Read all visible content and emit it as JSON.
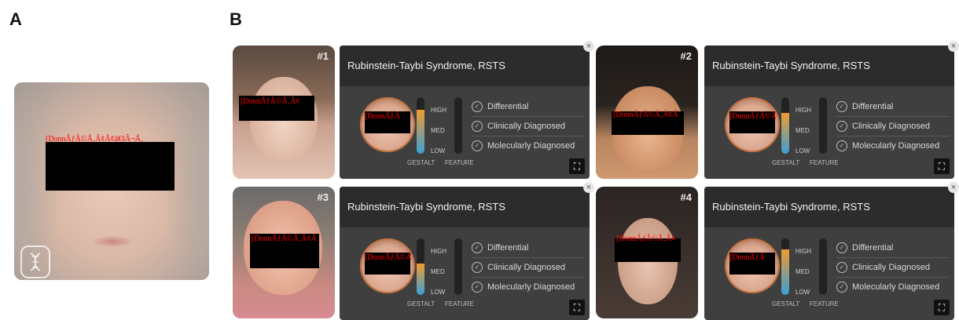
{
  "panels": {
    "a_label": "A",
    "b_label": "B"
  },
  "censor_text": {
    "composite": "[DonnÃƒÂ©Ã‚Â¢Ã¢â€šÂ¬Ã‚",
    "p1_photo": "[DonnÃƒÂ©Ã‚Â¢",
    "p2_photo": "[DonnÃƒÂ©Ã‚Â¢Ã",
    "p3_photo": "[DonnÃƒÂ©Ã‚Â¢Ã",
    "p4_photo": "[DonnÃƒÂ©Ã‚Â¢",
    "p1_thumb": "[DonnÃƒÂ",
    "p2_thumb": "[DonnÃƒÂ©Ã",
    "p3_thumb": "[DonnÃƒÂ©Ã",
    "p4_thumb": "[DonnÃƒÂ"
  },
  "patients": [
    {
      "num": "#1",
      "syndrome": "Rubinstein-Taybi Syndrome, RSTS",
      "gestalt_level": 0.78
    },
    {
      "num": "#2",
      "syndrome": "Rubinstein-Taybi Syndrome, RSTS",
      "gestalt_level": 0.72
    },
    {
      "num": "#3",
      "syndrome": "Rubinstein-Taybi Syndrome, RSTS",
      "gestalt_level": 0.55
    },
    {
      "num": "#4",
      "syndrome": "Rubinstein-Taybi Syndrome, RSTS",
      "gestalt_level": 0.8
    }
  ],
  "card_labels": {
    "high": "HIGH",
    "med": "MED",
    "low": "LOW",
    "gestalt": "GESTALT",
    "feature": "FEATURE",
    "opt1": "Differential",
    "opt2": "Clinically Diagnosed",
    "opt3": "Molecularly Diagnosed"
  },
  "colors": {
    "card_bg": "#3f3f3f",
    "card_header": "#2c2c2c",
    "accent": "#f29a2e"
  }
}
